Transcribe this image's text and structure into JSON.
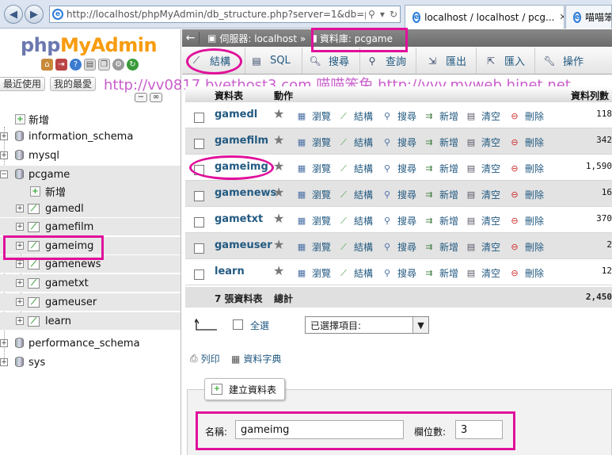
{
  "browser": {
    "url": "http://localhost/phpMyAdmin/db_structure.php?server=1&db=p",
    "tabs": [
      {
        "title": "localhost / localhost / pcg..."
      },
      {
        "title": "喵喵笨"
      }
    ],
    "back_icon": "back-arrow-icon",
    "forward_icon": "forward-arrow-icon"
  },
  "sidebar": {
    "logo_php": "php",
    "logo_myadmin": "MyAdmin",
    "recent_tab": "最近使用",
    "favorites_tab": "我的最愛",
    "tree": {
      "new_label": "新增",
      "databases": [
        "information_schema",
        "mysql",
        "pcgame",
        "performance_schema",
        "sys"
      ],
      "pcgame_children": {
        "new_label": "新增",
        "tables": [
          "gamedl",
          "gamefilm",
          "gameimg",
          "gamenews",
          "gametxt",
          "gameuser",
          "learn"
        ]
      }
    }
  },
  "breadcrumb": {
    "server": "伺服器: localhost »",
    "database": "資料庫: pcgame"
  },
  "main_tabs": [
    {
      "label": "結構",
      "icon": "structure-icon"
    },
    {
      "label": "SQL",
      "icon": "sql-icon"
    },
    {
      "label": "搜尋",
      "icon": "search-icon"
    },
    {
      "label": "查詢",
      "icon": "query-icon"
    },
    {
      "label": "匯出",
      "icon": "export-icon"
    },
    {
      "label": "匯入",
      "icon": "import-icon"
    },
    {
      "label": "操作",
      "icon": "wrench-icon"
    }
  ],
  "watermark": "http://vv0817.byethost3.com 喵喵笨兔 http://vvv.myweb.hinet.net",
  "table": {
    "headers": {
      "table": "資料表",
      "action": "動作",
      "rows": "資料列數"
    },
    "actions": {
      "browse": "瀏覽",
      "structure": "結構",
      "search": "搜尋",
      "insert": "新增",
      "empty": "清空",
      "drop": "刪除"
    },
    "rows": [
      {
        "name": "gamedl",
        "rows": "118"
      },
      {
        "name": "gamefilm",
        "rows": "342"
      },
      {
        "name": "gameimg",
        "rows": "1,590"
      },
      {
        "name": "gamenews",
        "rows": "16"
      },
      {
        "name": "gametxt",
        "rows": "370"
      },
      {
        "name": "gameuser",
        "rows": "2"
      },
      {
        "name": "learn",
        "rows": "12"
      }
    ],
    "footer": {
      "count": "7 張資料表",
      "total_label": "總計",
      "total_rows": "2,450"
    }
  },
  "bulk": {
    "select_all": "全選",
    "with_selected": "已選擇項目:"
  },
  "links": {
    "print": "列印",
    "dictionary": "資料字典"
  },
  "create_table": {
    "legend": "建立資料表",
    "name_label": "名稱:",
    "name_value": "gameimg",
    "cols_label": "欄位數:",
    "cols_value": "3"
  }
}
